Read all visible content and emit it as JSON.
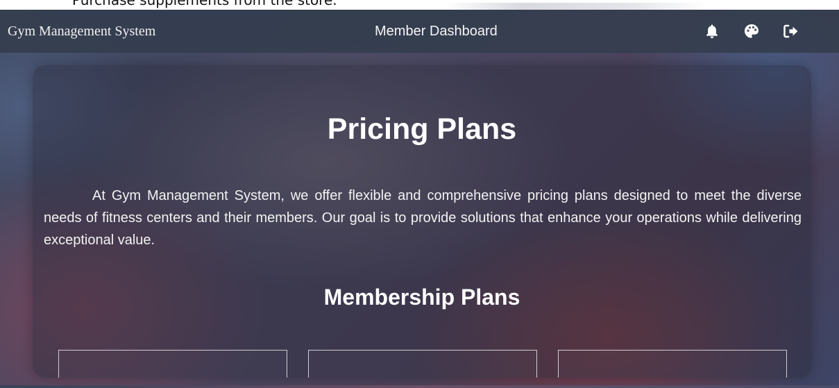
{
  "top_strip": {
    "text": "Purchase supplements from the store."
  },
  "navbar": {
    "brand": "Gym Management System",
    "title": "Member Dashboard",
    "icons": [
      "bell-icon",
      "palette-icon",
      "logout-icon"
    ]
  },
  "content": {
    "title": "Pricing Plans",
    "intro": "At Gym Management System, we offer flexible and comprehensive pricing plans designed to meet the diverse needs of fitness centers and their members. Our goal is to provide solutions that enhance your operations while delivering exceptional value.",
    "section_title": "Membership Plans"
  },
  "colors": {
    "navbar_bg": "#343e4e",
    "text": "#ffffff"
  }
}
